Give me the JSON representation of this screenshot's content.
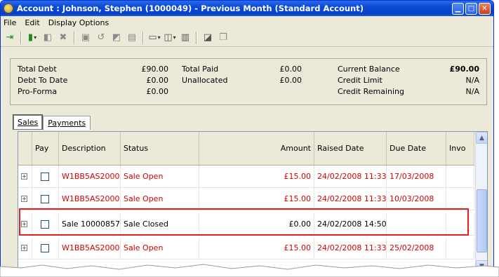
{
  "window": {
    "title": "Account : Johnson, Stephen (1000049) - Previous Month (Standard Account)"
  },
  "menu": {
    "items": [
      "File",
      "Edit",
      "Display Options"
    ]
  },
  "summary": {
    "total_debt_label": "Total Debt",
    "total_debt": "£90.00",
    "debt_to_date_label": "Debt To Date",
    "debt_to_date": "£0.00",
    "pro_forma_label": "Pro-Forma",
    "pro_forma": "£0.00",
    "total_paid_label": "Total Paid",
    "total_paid": "£0.00",
    "unallocated_label": "Unallocated",
    "unallocated": "£0.00",
    "current_balance_label": "Current Balance",
    "current_balance": "£90.00",
    "credit_limit_label": "Credit Limit",
    "credit_limit": "N/A",
    "credit_remaining_label": "Credit Remaining",
    "credit_remaining": "N/A"
  },
  "tabs": [
    {
      "label": "Sales",
      "active": true
    },
    {
      "label": "Payments",
      "active": false
    }
  ],
  "grid": {
    "columns": [
      "Pay",
      "Description",
      "Status",
      "Amount",
      "Raised Date",
      "Due Date",
      "Invo"
    ],
    "rows": [
      {
        "description": "W1BB5AS2000",
        "status": "Sale Open",
        "amount": "£15.00",
        "raised": "24/02/2008 11:33",
        "due": "17/03/2008",
        "red": true
      },
      {
        "description": "W1BB5AS2000",
        "status": "Sale Open",
        "amount": "£15.00",
        "raised": "24/02/2008 11:33",
        "due": "10/03/2008",
        "red": true
      },
      {
        "description": "Sale 10000857",
        "status": "Sale Closed",
        "amount": "£0.00",
        "raised": "24/02/2008 14:50",
        "due": "",
        "red": false
      },
      {
        "description": "W1BB5AS2000",
        "status": "Sale Open",
        "amount": "£15.00",
        "raised": "24/02/2008 11:33",
        "due": "25/02/2008",
        "red": true
      }
    ]
  },
  "colors": {
    "red_text": "#d40000",
    "highlight": "#e32020",
    "titlebar": "#0a49d6"
  }
}
